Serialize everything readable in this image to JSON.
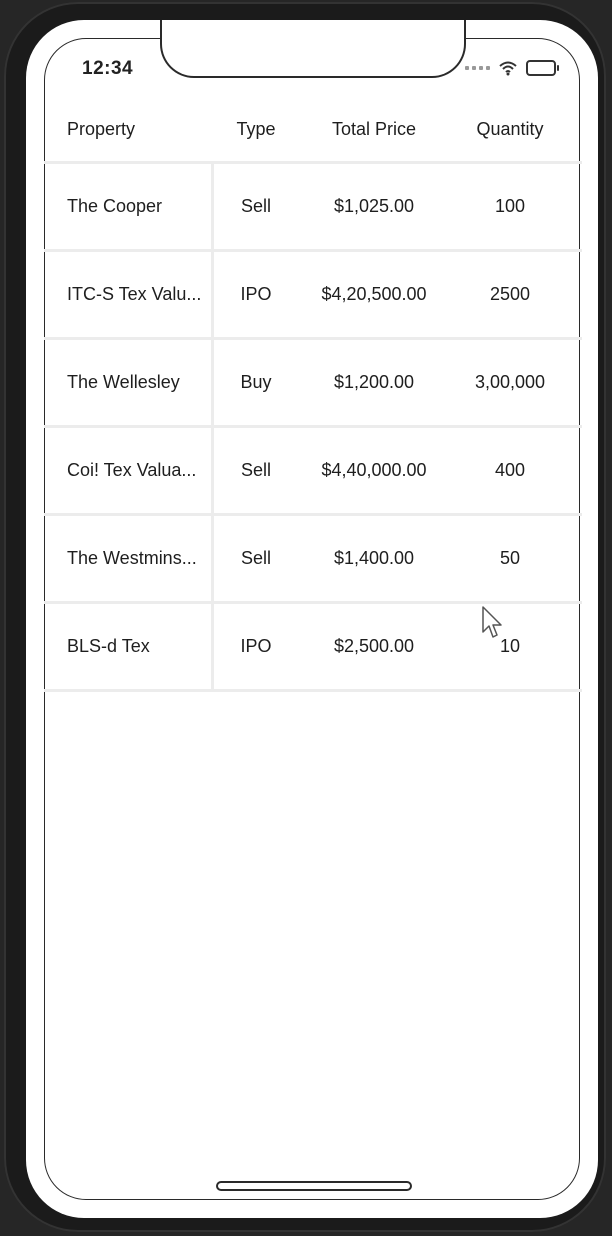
{
  "status_bar": {
    "time": "12:34"
  },
  "table": {
    "headers": {
      "property": "Property",
      "type": "Type",
      "total_price": "Total Price",
      "quantity": "Quantity"
    },
    "rows": [
      {
        "property": "The Cooper",
        "type": "Sell",
        "total_price": "$1,025.00",
        "quantity": "100"
      },
      {
        "property": "ITC-S Tex Valu...",
        "type": "IPO",
        "total_price": "$4,20,500.00",
        "quantity": "2500"
      },
      {
        "property": "The Wellesley",
        "type": "Buy",
        "total_price": "$1,200.00",
        "quantity": "3,00,000"
      },
      {
        "property": "Coi! Tex Valua...",
        "type": "Sell",
        "total_price": "$4,40,000.00",
        "quantity": "400"
      },
      {
        "property": "The Westmins...",
        "type": "Sell",
        "total_price": "$1,400.00",
        "quantity": "50"
      },
      {
        "property": "BLS-d Tex",
        "type": "IPO",
        "total_price": "$2,500.00",
        "quantity": "10"
      }
    ]
  },
  "icons": {
    "signal": "signal-icon",
    "wifi": "wifi-icon",
    "battery": "battery-icon",
    "cursor": "cursor-icon"
  }
}
